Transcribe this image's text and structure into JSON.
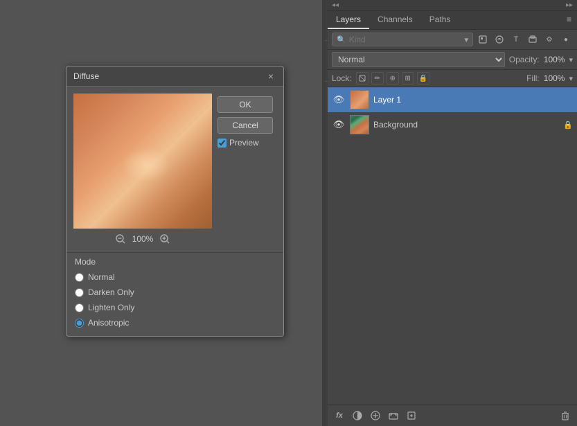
{
  "dialog": {
    "title": "Diffuse",
    "close_label": "×",
    "zoom_value": "100%",
    "buttons": {
      "ok": "OK",
      "cancel": "Cancel"
    },
    "preview_label": "Preview",
    "mode_section_label": "Mode",
    "modes": [
      {
        "id": "normal",
        "label": "Normal",
        "checked": false
      },
      {
        "id": "darken_only",
        "label": "Darken Only",
        "checked": false
      },
      {
        "id": "lighten_only",
        "label": "Lighten Only",
        "checked": false
      },
      {
        "id": "anisotropic",
        "label": "Anisotropic",
        "checked": true
      }
    ]
  },
  "layers_panel": {
    "tabs": [
      {
        "id": "layers",
        "label": "Layers",
        "active": true
      },
      {
        "id": "channels",
        "label": "Channels",
        "active": false
      },
      {
        "id": "paths",
        "label": "Paths",
        "active": false
      }
    ],
    "search_placeholder": "Kind",
    "blend_mode": "Normal",
    "opacity_label": "Opacity:",
    "opacity_value": "100%",
    "lock_label": "Lock:",
    "fill_label": "Fill:",
    "fill_value": "100%",
    "layers": [
      {
        "id": "layer1",
        "name": "Layer 1",
        "visible": true,
        "active": true,
        "locked": false
      },
      {
        "id": "background",
        "name": "Background",
        "visible": true,
        "active": false,
        "locked": true
      }
    ],
    "bottom_icons": [
      "fx",
      "circle-half",
      "adjustment",
      "folder",
      "trash"
    ]
  },
  "left_toolbar": {
    "icons": [
      "layers-icon",
      "play-icon",
      "tools-icon",
      "info-icon",
      "person-icon"
    ]
  },
  "icons": {
    "eye": "👁",
    "search": "🔍",
    "close": "✕",
    "lock": "🔒",
    "zoom_in": "+",
    "zoom_out": "−",
    "menu": "≡",
    "checkbox_checked": "✓"
  }
}
